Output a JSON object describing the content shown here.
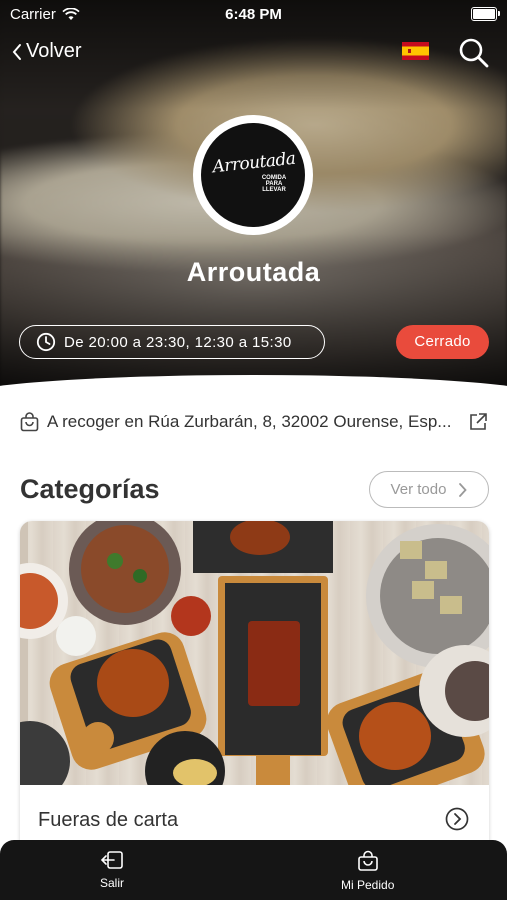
{
  "status_bar": {
    "carrier": "Carrier",
    "time": "6:48 PM"
  },
  "header": {
    "back_label": "Volver",
    "language": "es-flag-icon",
    "search": "search-icon"
  },
  "restaurant": {
    "name": "Arroutada",
    "logo_script": "Arroutada",
    "logo_tagline": "COMIDA PARA LLEVAR",
    "hours": "De 20:00 a 23:30, 12:30 a 15:30",
    "status": "Cerrado",
    "pickup_address": "A recoger en Rúa Zurbarán, 8, 32002 Ourense, Esp..."
  },
  "categories": {
    "title": "Categorías",
    "view_all_label": "Ver todo",
    "items": [
      {
        "label": "Fueras de carta"
      }
    ]
  },
  "tabbar": {
    "items": [
      {
        "label": "Salir",
        "icon": "logout-icon"
      },
      {
        "label": "Mi Pedido",
        "icon": "bag-icon"
      }
    ]
  },
  "colors": {
    "closed_badge": "#e94b3c",
    "tabbar": "#151515"
  }
}
